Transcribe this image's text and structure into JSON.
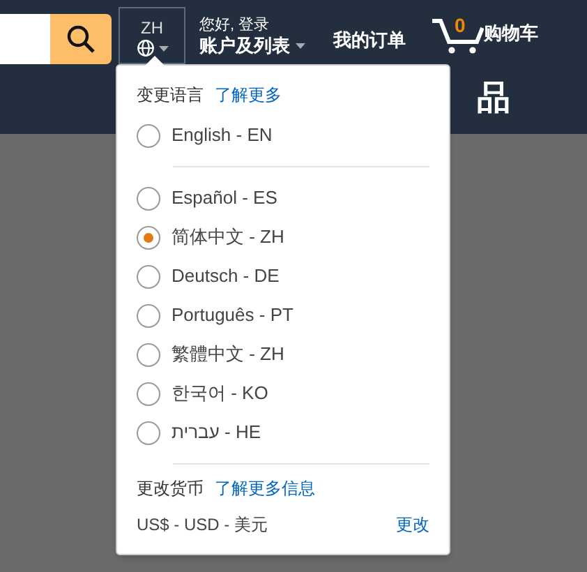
{
  "nav": {
    "language_code": "ZH",
    "greeting": "您好, 登录",
    "account": "账户及列表",
    "orders": "我的订单",
    "cart_count": "0",
    "cart": "购物车"
  },
  "heading": "品",
  "language_menu": {
    "title": "变更语言",
    "learn_more": "了解更多",
    "primary": [
      {
        "label": "English - EN",
        "selected": false
      }
    ],
    "languages": [
      {
        "label": "Español - ES",
        "selected": false
      },
      {
        "label": "简体中文 - ZH",
        "selected": true
      },
      {
        "label": "Deutsch - DE",
        "selected": false
      },
      {
        "label": "Português - PT",
        "selected": false
      },
      {
        "label": "繁體中文 - ZH",
        "selected": false
      },
      {
        "label": "한국어 - KO",
        "selected": false
      },
      {
        "label": "עברית - HE",
        "selected": false
      }
    ],
    "currency_title": "更改货币",
    "currency_learn_more": "了解更多信息",
    "currency": "US$ - USD - 美元",
    "change": "更改"
  }
}
